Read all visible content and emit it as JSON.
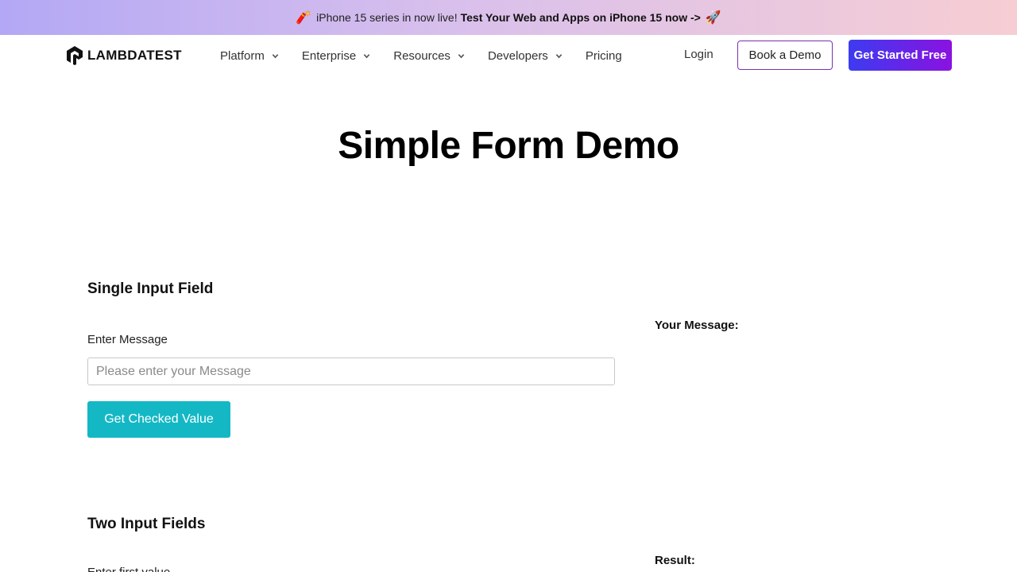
{
  "banner": {
    "emoji_left": "🧨",
    "text": "iPhone 15 series in now live!",
    "link_text": "Test Your Web and Apps on iPhone 15 now ->",
    "emoji_right": "🚀"
  },
  "nav": {
    "logo_text": "LAMBDATEST",
    "menu": [
      {
        "label": "Platform",
        "has_dropdown": true
      },
      {
        "label": "Enterprise",
        "has_dropdown": true
      },
      {
        "label": "Resources",
        "has_dropdown": true
      },
      {
        "label": "Developers",
        "has_dropdown": true
      },
      {
        "label": "Pricing",
        "has_dropdown": false
      }
    ],
    "login_label": "Login",
    "book_demo_label": "Book a Demo",
    "get_started_label": "Get Started Free"
  },
  "page": {
    "title": "Simple Form Demo"
  },
  "single_input": {
    "section_title": "Single Input Field",
    "label": "Enter Message",
    "placeholder": "Please enter your Message",
    "value": "",
    "button_label": "Get Checked Value",
    "output_label": "Your Message:"
  },
  "two_inputs": {
    "section_title": "Two Input Fields",
    "first_label": "Enter first value",
    "result_label": "Result:"
  },
  "colors": {
    "accent_button": "#14b8c5",
    "cta_gradient_start": "#3d3bf0",
    "cta_gradient_end": "#8a12e0",
    "demo_border": "#7b2fb0"
  }
}
